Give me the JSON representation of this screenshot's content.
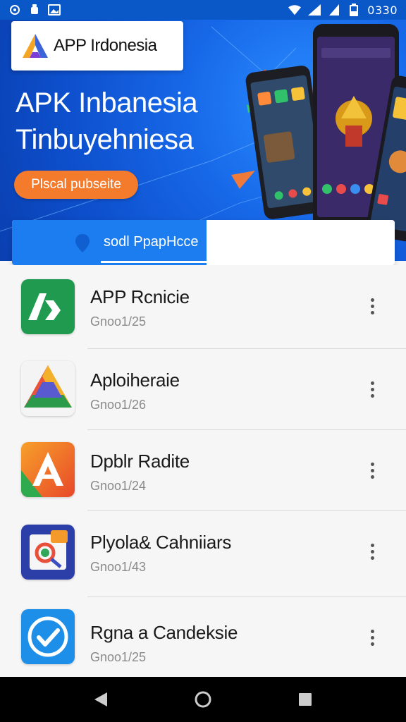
{
  "status_bar": {
    "time": "0330",
    "left_icons": [
      "settings-icon",
      "android-icon",
      "image-icon"
    ],
    "right_icons": [
      "wifi-icon",
      "signal-icon",
      "signal-icon",
      "battery-icon"
    ]
  },
  "hero": {
    "logo_text": "APP Irdonesia",
    "title": "APK Inbanesia",
    "subtitle": "Tinbuyehniesa",
    "cta_label": "Plscal pubseite",
    "colors": {
      "banner": "#1768e8",
      "cta": "#f47a2c"
    }
  },
  "search": {
    "text": "sodl PpapHcce",
    "icon": "location-pin-icon"
  },
  "apps": [
    {
      "name": "APP Rcnicie",
      "meta": "Gnoo1/25",
      "icon": "green-ap-icon"
    },
    {
      "name": "Aploiheraie",
      "meta": "Gnoo1/26",
      "icon": "drive-triangle-icon"
    },
    {
      "name": "Dpblr Radite",
      "meta": "Gnoo1/24",
      "icon": "orange-a-icon"
    },
    {
      "name": "Plyola& Cahniiars",
      "meta": "Gnoo1/43",
      "icon": "photo-search-icon"
    },
    {
      "name": "Rgna a Candeksie",
      "meta": "Gnoo1/25",
      "icon": "check-circle-icon"
    }
  ],
  "nav": {
    "icons": [
      "back-icon",
      "home-icon",
      "recents-icon"
    ]
  }
}
